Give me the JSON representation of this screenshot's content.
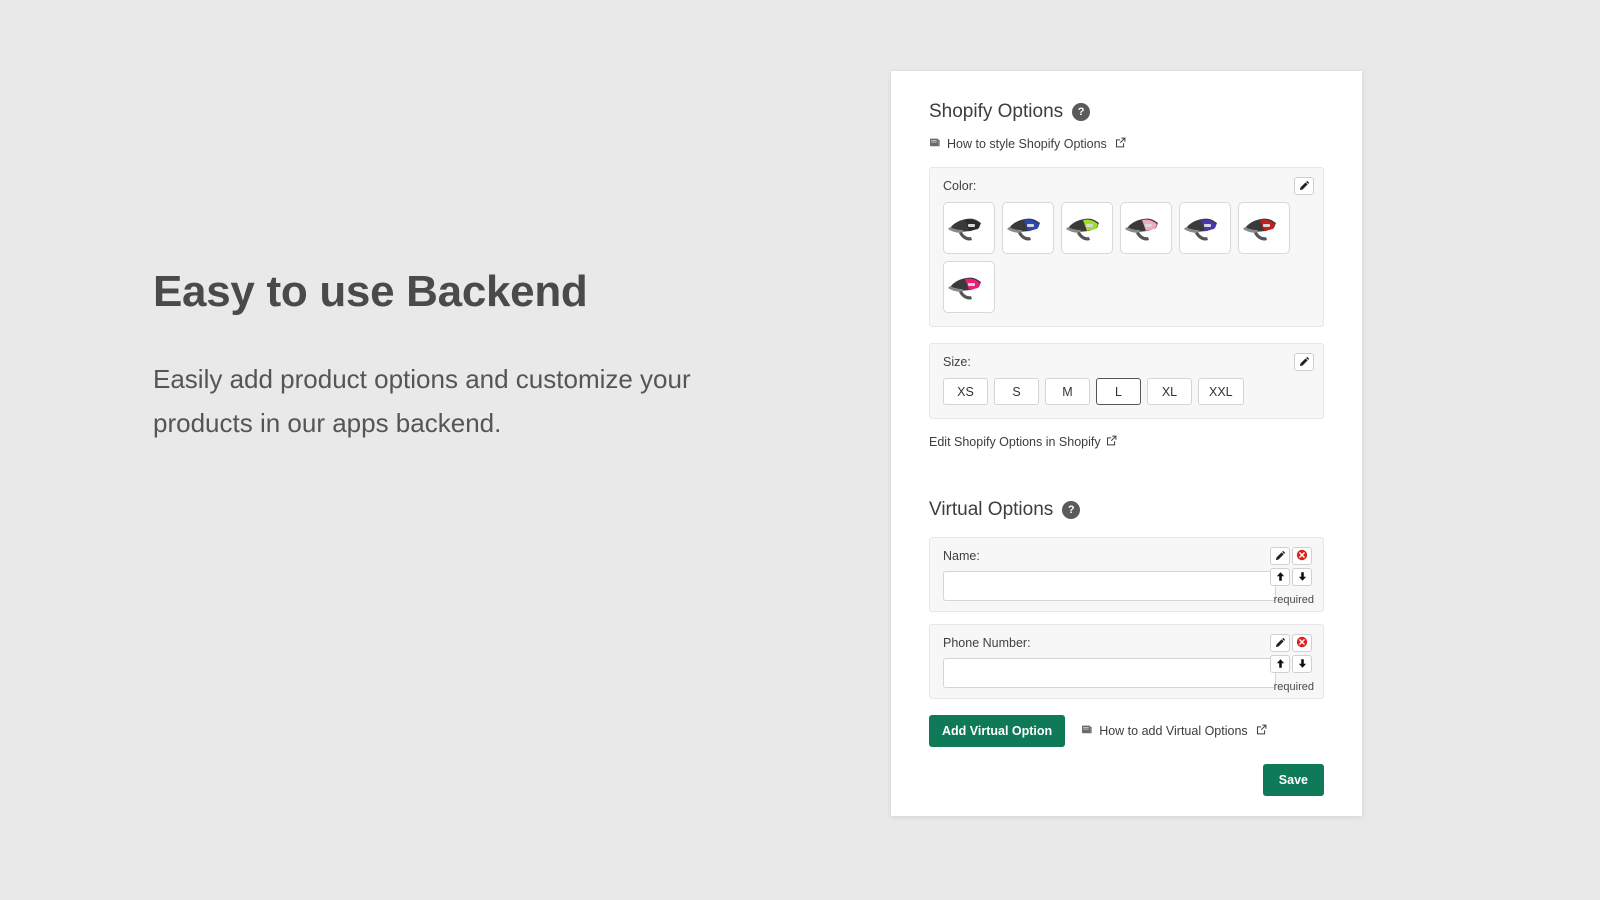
{
  "promo": {
    "title": "Easy to use Backend",
    "body": "Easily add product options and customize your products in our apps backend."
  },
  "card": {
    "shopify_options": {
      "heading": "Shopify Options",
      "help_badge": "?",
      "doc_link": "How to style Shopify Options",
      "color_group": {
        "label": "Color:",
        "edit_icon": "pencil-icon",
        "swatches": [
          {
            "name": "Black",
            "color": "#2b2b2b"
          },
          {
            "name": "Blue",
            "color": "#2a48b8"
          },
          {
            "name": "Green",
            "color": "#9ede2a"
          },
          {
            "name": "Pink",
            "color": "#f2a8c8"
          },
          {
            "name": "Purple",
            "color": "#4b35b5"
          },
          {
            "name": "Red",
            "color": "#c22020"
          },
          {
            "name": "Hot Pink",
            "color": "#ee1f7a"
          }
        ]
      },
      "size_group": {
        "label": "Size:",
        "edit_icon": "pencil-icon",
        "sizes": [
          "XS",
          "S",
          "M",
          "L",
          "XL",
          "XXL"
        ],
        "selected": "L"
      },
      "edit_in_shopify_link": "Edit Shopify Options in Shopify"
    },
    "virtual_options": {
      "heading": "Virtual Options",
      "help_badge": "?",
      "rows": [
        {
          "label": "Name:",
          "value": "",
          "required_text": "required"
        },
        {
          "label": "Phone Number:",
          "value": "",
          "required_text": "required"
        }
      ],
      "add_button": "Add Virtual Option",
      "doc_link": "How to add Virtual Options",
      "save_button": "Save"
    }
  },
  "colors": {
    "page_bg": "#e9e9e9",
    "card_bg": "#ffffff",
    "accent_green": "#0e7a57",
    "group_bg": "#f7f7f7",
    "delete_red": "#d9251d",
    "text": "#3d3d3d"
  }
}
